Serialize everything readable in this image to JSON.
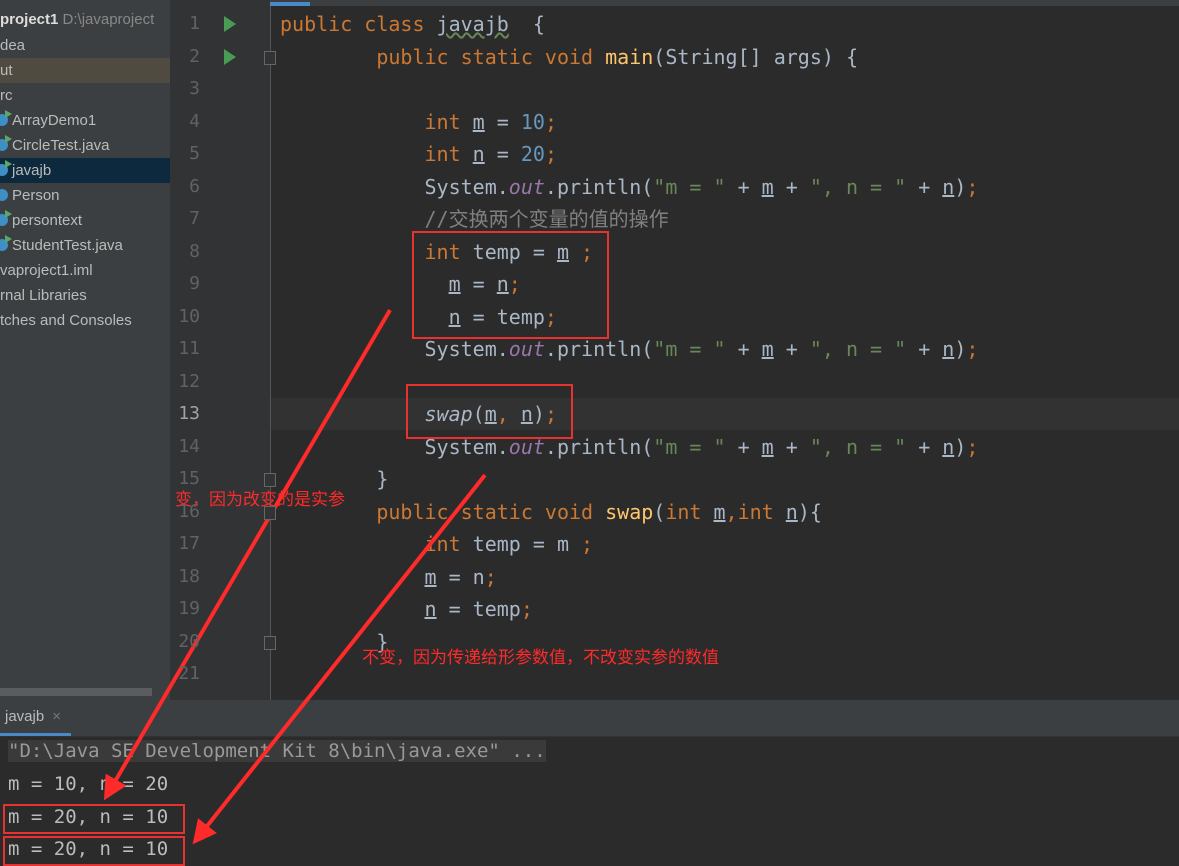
{
  "sidebar": {
    "project": "project1",
    "project_path": "D:\\javaproject",
    "items": [
      {
        "label": "dea",
        "icon": null
      },
      {
        "label": "ut",
        "icon": null,
        "state": "selected-dir"
      },
      {
        "label": "rc",
        "icon": null
      },
      {
        "label": "ArrayDemo1",
        "icon": "run-class"
      },
      {
        "label": "CircleTest.java",
        "icon": "run-class"
      },
      {
        "label": "javajb",
        "icon": "run-class",
        "state": "selected"
      },
      {
        "label": "Person",
        "icon": "class"
      },
      {
        "label": "persontext",
        "icon": "run-class"
      },
      {
        "label": "StudentTest.java",
        "icon": "run-class"
      },
      {
        "label": "vaproject1.iml",
        "icon": null
      },
      {
        "label": "rnal Libraries",
        "icon": null
      },
      {
        "label": "tches and Consoles",
        "icon": null
      }
    ]
  },
  "editor": {
    "current_line": 13,
    "lines": [
      [
        [
          "kw",
          "public class "
        ],
        [
          "wv",
          "javajb"
        ],
        [
          "",
          "  {"
        ]
      ],
      [
        [
          "",
          "        "
        ],
        [
          "kw",
          "public static void "
        ],
        [
          "fn",
          "main"
        ],
        [
          "",
          "(String[] args) {"
        ]
      ],
      [],
      [
        [
          "",
          "            "
        ],
        [
          "kw",
          "int "
        ],
        [
          "ul",
          "m"
        ],
        [
          "",
          " = "
        ],
        [
          "num",
          "10"
        ],
        [
          "kw",
          ";"
        ]
      ],
      [
        [
          "",
          "            "
        ],
        [
          "kw",
          "int "
        ],
        [
          "ul",
          "n"
        ],
        [
          "",
          " = "
        ],
        [
          "num",
          "20"
        ],
        [
          "kw",
          ";"
        ]
      ],
      [
        [
          "",
          "            System."
        ],
        [
          "fld",
          "out"
        ],
        [
          "",
          ".println("
        ],
        [
          "str",
          "\"m = \""
        ],
        [
          "",
          " + "
        ],
        [
          "ul",
          "m"
        ],
        [
          "",
          " + "
        ],
        [
          "str",
          "\", n = \""
        ],
        [
          "",
          " + "
        ],
        [
          "ul",
          "n"
        ],
        [
          "",
          ")"
        ],
        [
          "kw",
          ";"
        ]
      ],
      [
        [
          "",
          "            "
        ],
        [
          "cm",
          "//交换两个变量的值的操作"
        ]
      ],
      [
        [
          "",
          "            "
        ],
        [
          "kw",
          "int "
        ],
        [
          "",
          "temp = "
        ],
        [
          "ul",
          "m"
        ],
        [
          "kw",
          " ;"
        ]
      ],
      [
        [
          "",
          "              "
        ],
        [
          "ul",
          "m"
        ],
        [
          "",
          " = "
        ],
        [
          "ul",
          "n"
        ],
        [
          "kw",
          ";"
        ]
      ],
      [
        [
          "",
          "              "
        ],
        [
          "ul",
          "n"
        ],
        [
          "",
          " = temp"
        ],
        [
          "kw",
          ";"
        ]
      ],
      [
        [
          "",
          "            System."
        ],
        [
          "fld",
          "out"
        ],
        [
          "",
          ".println("
        ],
        [
          "str",
          "\"m = \""
        ],
        [
          "",
          " + "
        ],
        [
          "ul",
          "m"
        ],
        [
          "",
          " + "
        ],
        [
          "str",
          "\", n = \""
        ],
        [
          "",
          " + "
        ],
        [
          "ul",
          "n"
        ],
        [
          "",
          ")"
        ],
        [
          "kw",
          ";"
        ]
      ],
      [],
      [
        [
          "",
          "            "
        ],
        [
          "it",
          "swap"
        ],
        [
          "",
          "("
        ],
        [
          "ul",
          "m"
        ],
        [
          "kw",
          ", "
        ],
        [
          "ul",
          "n"
        ],
        [
          "",
          ")"
        ],
        [
          "kw",
          ";"
        ]
      ],
      [
        [
          "",
          "            System."
        ],
        [
          "fld",
          "out"
        ],
        [
          "",
          ".println("
        ],
        [
          "str",
          "\"m = \""
        ],
        [
          "",
          " + "
        ],
        [
          "ul",
          "m"
        ],
        [
          "",
          " + "
        ],
        [
          "str",
          "\", n = \""
        ],
        [
          "",
          " + "
        ],
        [
          "ul",
          "n"
        ],
        [
          "",
          ")"
        ],
        [
          "kw",
          ";"
        ]
      ],
      [
        [
          "",
          "        }"
        ]
      ],
      [
        [
          "",
          "        "
        ],
        [
          "kw",
          "public static void "
        ],
        [
          "fn",
          "swap"
        ],
        [
          "",
          "("
        ],
        [
          "kw",
          "int "
        ],
        [
          "ul",
          "m"
        ],
        [
          "kw",
          ","
        ],
        [
          "kw",
          "int "
        ],
        [
          "ul",
          "n"
        ],
        [
          "",
          "){"
        ]
      ],
      [
        [
          "",
          "            "
        ],
        [
          "kw",
          "int "
        ],
        [
          "",
          "temp = m "
        ],
        [
          "kw",
          ";"
        ]
      ],
      [
        [
          "",
          "            "
        ],
        [
          "ul",
          "m"
        ],
        [
          "",
          " = n"
        ],
        [
          "kw",
          ";"
        ]
      ],
      [
        [
          "",
          "            "
        ],
        [
          "ul",
          "n"
        ],
        [
          "",
          " = temp"
        ],
        [
          "kw",
          ";"
        ]
      ],
      [
        [
          "",
          "        }"
        ]
      ],
      []
    ]
  },
  "console": {
    "tab": "javajb",
    "close": "×",
    "command": "\"D:\\Java SE Development Kit 8\\bin\\java.exe\" ...",
    "output": [
      "m = 10, n = 20",
      "m = 20, n = 10",
      "m = 20, n = 10"
    ]
  },
  "annotations": {
    "note1": "变，因为改变的是实参",
    "note2": "不变，因为传递给形参数值，不改变实参的数值",
    "color": "#ff2a2a"
  }
}
